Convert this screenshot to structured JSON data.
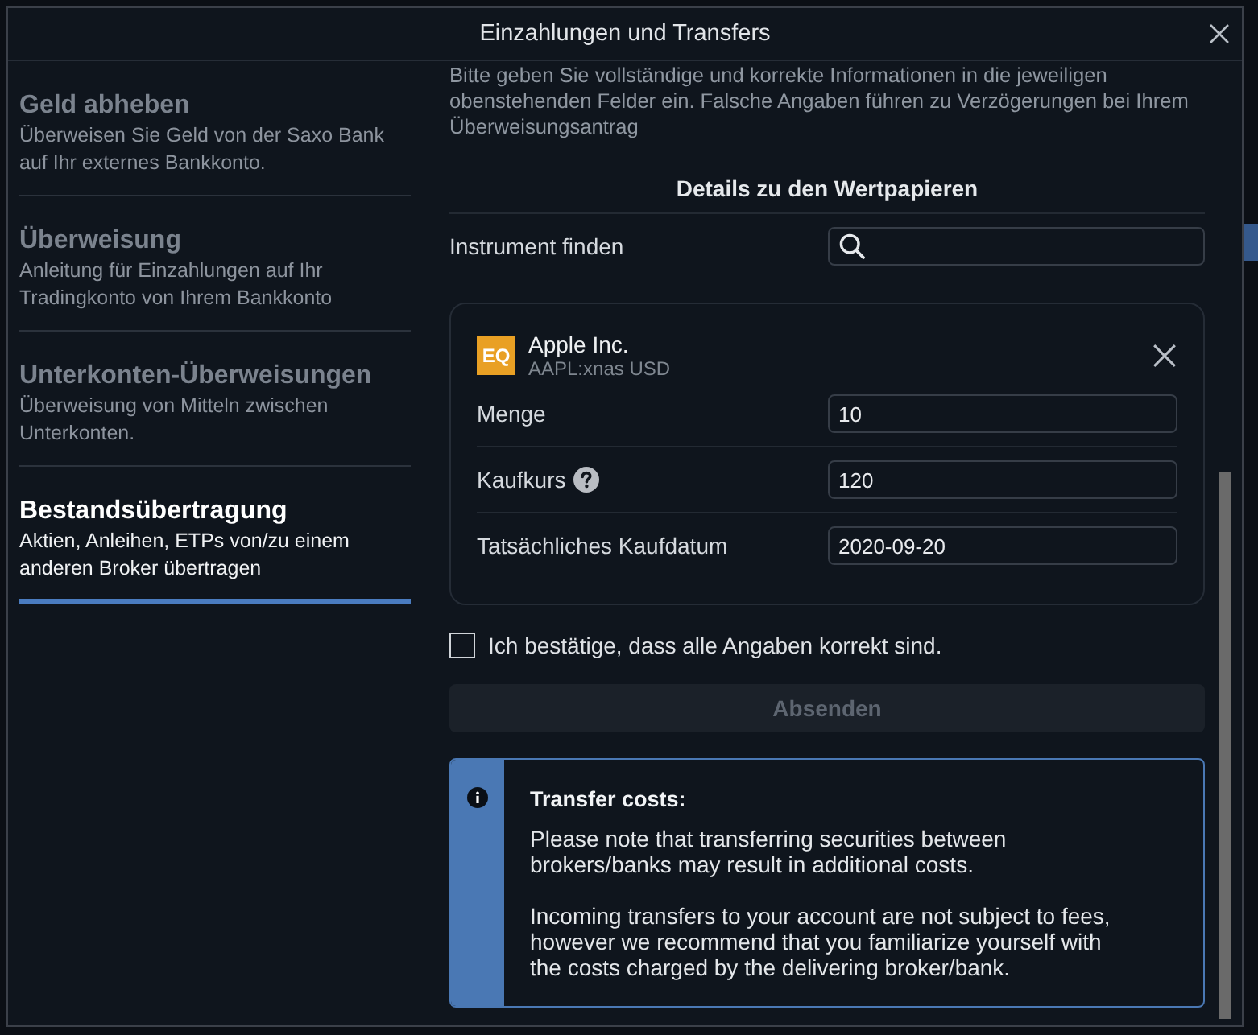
{
  "window": {
    "title": "Einzahlungen und Transfers"
  },
  "sidebar": {
    "items": [
      {
        "title": "Geld abheben",
        "description": "Überweisen Sie Geld von der Saxo Bank auf Ihr externes Bankkonto.",
        "selected": false
      },
      {
        "title": "Überweisung",
        "description": "Anleitung für Einzahlungen auf Ihr Tradingkonto von Ihrem Bankkonto",
        "selected": false
      },
      {
        "title": "Unterkonten-Überweisungen",
        "description": "Überweisung von Mitteln zwischen Unterkonten.",
        "selected": false
      },
      {
        "title": "Bestandsübertragung",
        "description": "Aktien, Anleihen, ETPs von/zu einem anderen Broker übertragen",
        "selected": true
      }
    ]
  },
  "content": {
    "intro": "Bitte geben Sie vollständige und korrekte Informationen in die jeweiligen obenstehenden Felder ein. Falsche Angaben führen zu Verzögerungen bei Ihrem Überweisungsantrag",
    "section_title": "Details zu den Wertpapieren",
    "search": {
      "label": "Instrument finden"
    },
    "instrument": {
      "badge": "EQ",
      "name": "Apple Inc.",
      "symbol": "AAPL:xnas USD",
      "fields": [
        {
          "label": "Menge",
          "value": "10",
          "help": false
        },
        {
          "label": "Kaufkurs",
          "value": "120",
          "help": true
        },
        {
          "label": "Tatsächliches Kaufdatum",
          "value": "2020-09-20",
          "help": false
        }
      ]
    },
    "confirm": {
      "label": "Ich bestätige, dass alle Angaben korrekt sind.",
      "checked": false
    },
    "submit": {
      "label": "Absenden",
      "disabled": true
    },
    "notice": {
      "title": "Transfer costs:",
      "paragraphs": [
        "Please note that transferring securities between brokers/banks may result in additional costs.",
        "Incoming transfers to your account are not subject to fees, however we recommend that you familiarize yourself with the costs charged by the delivering broker/bank."
      ]
    }
  }
}
